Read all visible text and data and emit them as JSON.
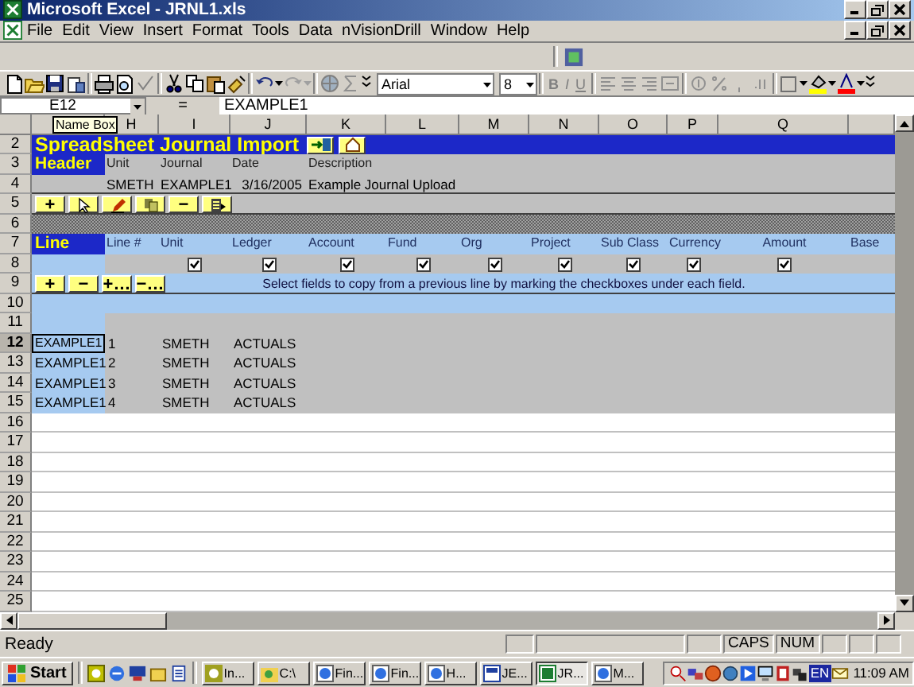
{
  "window": {
    "title": "Microsoft Excel - JRNL1.xls"
  },
  "menu": [
    "File",
    "Edit",
    "View",
    "Insert",
    "Format",
    "Tools",
    "Data",
    "nVisionDrill",
    "Window",
    "Help"
  ],
  "toolbar": {
    "font": "Arial",
    "size": "8",
    "format_buttons": [
      "B",
      "I",
      "U"
    ]
  },
  "formula_bar": {
    "name_box": "E12",
    "sign": "=",
    "value": "EXAMPLE1",
    "tooltip": "Name Box"
  },
  "columns": [
    "H",
    "I",
    "J",
    "K",
    "L",
    "M",
    "N",
    "O",
    "P",
    "Q"
  ],
  "row_headers": [
    {
      "label": "2",
      "selected": false
    },
    {
      "label": "3",
      "selected": false
    },
    {
      "label": "4",
      "selected": false
    },
    {
      "label": "5",
      "selected": false
    },
    {
      "label": "6",
      "selected": false
    },
    {
      "label": "7",
      "selected": false
    },
    {
      "label": "8",
      "selected": false
    },
    {
      "label": "9",
      "selected": false
    },
    {
      "label": "10",
      "selected": false
    },
    {
      "label": "11",
      "selected": false
    },
    {
      "label": "12",
      "selected": true
    },
    {
      "label": "13",
      "selected": false
    },
    {
      "label": "14",
      "selected": false
    },
    {
      "label": "15",
      "selected": false
    },
    {
      "label": "16",
      "selected": false
    },
    {
      "label": "17",
      "selected": false
    },
    {
      "label": "18",
      "selected": false
    },
    {
      "label": "19",
      "selected": false
    },
    {
      "label": "20",
      "selected": false
    },
    {
      "label": "21",
      "selected": false
    },
    {
      "label": "22",
      "selected": false
    },
    {
      "label": "23",
      "selected": false
    },
    {
      "label": "24",
      "selected": false
    },
    {
      "label": "25",
      "selected": false
    }
  ],
  "sheet": {
    "title": "Spreadsheet Journal Import",
    "title_buttons": [
      {
        "kind": "import"
      },
      {
        "kind": "home"
      }
    ],
    "header": {
      "label": "Header",
      "fields": [
        {
          "label": "Unit",
          "value": "SMETH"
        },
        {
          "label": "Journal",
          "value": "EXAMPLE1"
        },
        {
          "label": "Date",
          "value": "3/16/2005"
        },
        {
          "label": "Description",
          "value": "Example Journal Upload"
        }
      ]
    },
    "header_buttons": [
      {
        "kind": "text",
        "label": "+"
      },
      {
        "kind": "cursor"
      },
      {
        "kind": "pencil"
      },
      {
        "kind": "copy"
      },
      {
        "kind": "text",
        "label": "−"
      },
      {
        "kind": "list"
      }
    ],
    "line": {
      "label": "Line",
      "fields": [
        {
          "label": "Line #"
        },
        {
          "label": "Unit",
          "checked": true
        },
        {
          "label": "Ledger",
          "checked": true
        },
        {
          "label": "Account",
          "checked": true
        },
        {
          "label": "Fund",
          "checked": true
        },
        {
          "label": "Org",
          "checked": true
        },
        {
          "label": "Project",
          "checked": true
        },
        {
          "label": "Sub Class",
          "checked": true
        },
        {
          "label": "Currency",
          "checked": true
        },
        {
          "label": "Amount",
          "checked": true
        },
        {
          "label": "Base"
        }
      ]
    },
    "line_buttons": [
      {
        "kind": "text",
        "label": "+"
      },
      {
        "kind": "text",
        "label": "−"
      },
      {
        "kind": "text",
        "label": "+…"
      },
      {
        "kind": "text",
        "label": "−…"
      }
    ],
    "hint": "Select fields to copy from a previous line by marking the checkboxes under each field.",
    "lines": [
      {
        "journal": "EXAMPLE1",
        "line": "1",
        "unit": "SMETH",
        "ledger": "ACTUALS"
      },
      {
        "journal": "EXAMPLE1",
        "line": "2",
        "unit": "SMETH",
        "ledger": "ACTUALS"
      },
      {
        "journal": "EXAMPLE1",
        "line": "3",
        "unit": "SMETH",
        "ledger": "ACTUALS"
      },
      {
        "journal": "EXAMPLE1",
        "line": "4",
        "unit": "SMETH",
        "ledger": "ACTUALS"
      }
    ]
  },
  "status_bar": {
    "text": "Ready",
    "indicators": [
      "CAPS",
      "NUM"
    ]
  },
  "taskbar": {
    "start": "Start",
    "tasks": [
      {
        "label": "In...",
        "kind": "app",
        "selected": false
      },
      {
        "label": "C:\\",
        "kind": "explorer",
        "selected": false
      },
      {
        "label": "Fin...",
        "kind": "browser",
        "selected": false
      },
      {
        "label": "Fin...",
        "kind": "browser",
        "selected": false
      },
      {
        "label": "H...",
        "kind": "browser",
        "selected": false
      },
      {
        "label": "JE...",
        "kind": "doc",
        "selected": false
      },
      {
        "label": "JR...",
        "kind": "excel",
        "selected": true
      },
      {
        "label": "M...",
        "kind": "browser",
        "selected": false
      }
    ],
    "language": "EN",
    "clock": "11:09 AM"
  }
}
